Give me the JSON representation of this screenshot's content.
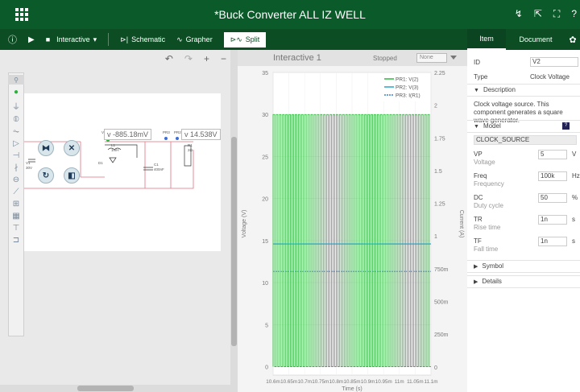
{
  "app": {
    "title": "*Buck Converter ALL IZ WELL"
  },
  "toolbar": {
    "mode": "Interactive",
    "schematic": "Schematic",
    "grapher": "Grapher",
    "split": "Split"
  },
  "panel_tabs": {
    "item": "Item",
    "document": "Document"
  },
  "schematic": {
    "probe_v2": "V(2)",
    "probe_voltage_1": "v -885.18mV",
    "probe_pr3": "PR3",
    "probe_pr2": "PR2",
    "probe_voltage_2": "v 14.538V",
    "labels": {
      "v1": "V1",
      "v1_val": "30V",
      "l1": "L1",
      "l1_val": "1mH",
      "c1": "C1",
      "c1_val": "400nF",
      "r1": "R1",
      "r1_val": "2Ω",
      "d1": "D1"
    }
  },
  "graph": {
    "title": "Interactive 1",
    "status": "Stopped",
    "select": "None"
  },
  "chart_data": {
    "type": "line",
    "xlabel": "Time (s)",
    "ylabel": "Voltage (V)",
    "y2label": "Current (A)",
    "x_ticks": [
      "10.6m",
      "10.65m",
      "10.7m",
      "10.75m",
      "10.8m",
      "10.85m",
      "10.9m",
      "10.95m",
      "11m",
      "11.05m",
      "11.1m"
    ],
    "xlim": [
      0.0106,
      0.0111
    ],
    "ylim": [
      -1,
      35
    ],
    "y_ticks": [
      0,
      5,
      10,
      15,
      20,
      25,
      30,
      35
    ],
    "y2lim": [
      -0.0625,
      2.25
    ],
    "y2_ticks": [
      "0",
      "250m",
      "500m",
      "750m",
      "1",
      "1.25",
      "1.5",
      "1.75",
      "2",
      "2.25"
    ],
    "grid": true,
    "legend": "top-right",
    "series": [
      {
        "name": "PR1: V(2)",
        "color": "#22b431",
        "kind": "square-wave",
        "low": 0,
        "high": 30,
        "frequency": 100000,
        "duty": 0.5
      },
      {
        "name": "PR2: V(3)",
        "color": "#1aa0c8",
        "kind": "constant",
        "value": 14.6
      },
      {
        "name": "PR3: I(R1)",
        "color": "#3f7fd0",
        "kind": "constant",
        "value": 0.73
      }
    ]
  },
  "properties": {
    "id_label": "ID",
    "id_value": "V2",
    "type_label": "Type",
    "type_value": "Clock Voltage",
    "description_header": "Description",
    "description_text": "Clock voltage source. This component generates a square wave generator.",
    "model_header": "Model",
    "model_badge": "?",
    "model_name": "CLOCK_SOURCE",
    "params": [
      {
        "name": "VP",
        "desc": "Voltage",
        "value": "5",
        "unit": "V"
      },
      {
        "name": "Freq",
        "desc": "Frequency",
        "value": "100k",
        "unit": "Hz"
      },
      {
        "name": "DC",
        "desc": "Duty cycle",
        "value": "50",
        "unit": "%"
      },
      {
        "name": "TR",
        "desc": "Rise time",
        "value": "1n",
        "unit": "s"
      },
      {
        "name": "TF",
        "desc": "Fall time",
        "value": "1n",
        "unit": "s"
      }
    ],
    "symbol_header": "Symbol",
    "details_header": "Details"
  },
  "colors": {
    "title_bg": "#0a5a2a",
    "toolbar_bg": "#0c4d24",
    "wave": "#22b431",
    "v3": "#1aa0c8"
  }
}
